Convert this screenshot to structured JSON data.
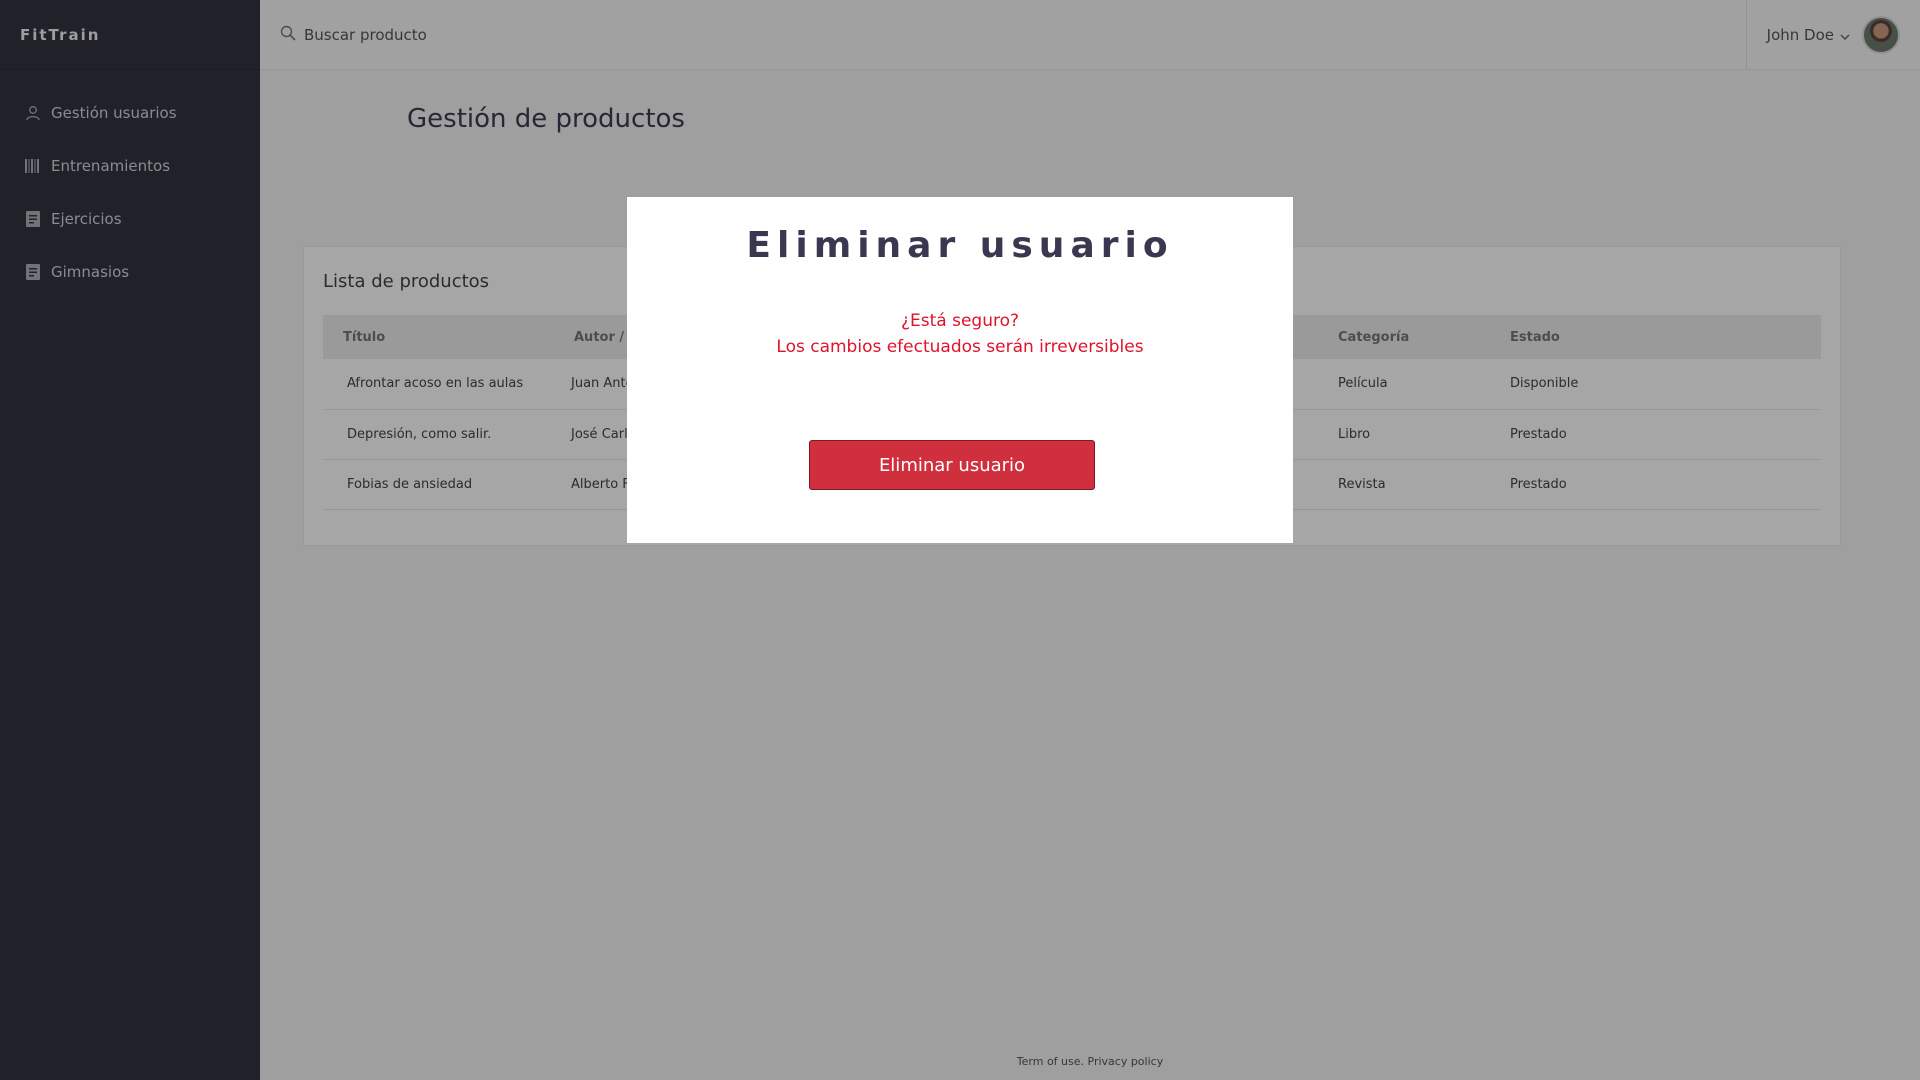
{
  "app": {
    "brand": "FitTrain"
  },
  "sidebar": {
    "items": [
      {
        "label": "Gestión usuarios",
        "icon": "user-icon"
      },
      {
        "label": "Entrenamientos",
        "icon": "barcode-icon"
      },
      {
        "label": "Ejercicios",
        "icon": "document-icon"
      },
      {
        "label": "Gimnasios",
        "icon": "document-icon"
      }
    ]
  },
  "header": {
    "search_placeholder": "Buscar producto",
    "user_name": "John Doe"
  },
  "main": {
    "page_title": "Gestión de productos",
    "card_title": "Lista de productos",
    "table": {
      "columns": [
        "Título",
        "Autor /",
        "Categoría",
        "Estado"
      ],
      "rows": [
        {
          "titulo": "Afrontar acoso en las aulas",
          "autor": "Juan Ante",
          "categoria": "Película",
          "estado": "Disponible"
        },
        {
          "titulo": "Depresión, como salir.",
          "autor": "José Carl",
          "categoria": "Libro",
          "estado": "Prestado"
        },
        {
          "titulo": "Fobias de ansiedad",
          "autor": "Alberto F",
          "categoria": "Revista",
          "estado": "Prestado"
        }
      ]
    }
  },
  "footer": {
    "text": "Term of use. Privacy policy"
  },
  "modal": {
    "title": "Eliminar usuario",
    "question": "¿Está seguro?",
    "warning": "Los cambios efectuados serán irreversibles",
    "button_label": "Eliminar usuario"
  },
  "colors": {
    "sidebar_bg": "#333340",
    "danger": "#d0303d",
    "warning_text": "#e0112b"
  }
}
